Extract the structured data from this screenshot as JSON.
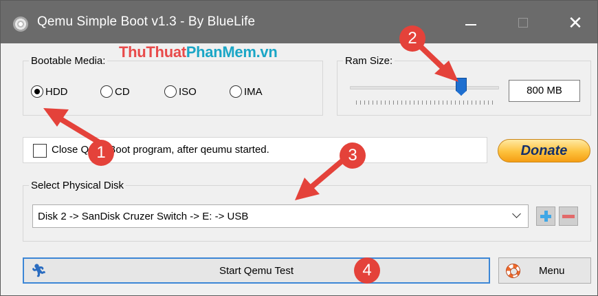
{
  "window": {
    "title": "Qemu Simple Boot v1.3 - By BlueLife",
    "icon": "cd-disc-icon",
    "controls": {
      "minimize": "–",
      "maximize": "□",
      "close": "✕"
    }
  },
  "watermark": {
    "part1": "ThuThuat",
    "part2": "PhanMem",
    "part3": ".vn"
  },
  "bootable_media": {
    "title": "Bootable Media:",
    "options": [
      {
        "label": "HDD",
        "checked": true
      },
      {
        "label": "CD",
        "checked": false
      },
      {
        "label": "ISO",
        "checked": false
      },
      {
        "label": "IMA",
        "checked": false
      }
    ]
  },
  "ram": {
    "title": "Ram Size:",
    "value": "800 MB",
    "slider_fraction": 0.72
  },
  "close_option": {
    "label": "Close QemuBoot program, after qeumu started.",
    "checked": false
  },
  "donate": {
    "label": "Donate"
  },
  "disk": {
    "title": "Select Physical Disk",
    "selected": "Disk 2 -> SanDisk Cruzer Switch -> E: -> USB",
    "add_label": "+",
    "remove_label": "−"
  },
  "actions": {
    "start_label": "Start Qemu Test",
    "menu_label": "Menu"
  },
  "annotations": {
    "step1": "1",
    "step2": "2",
    "step3": "3",
    "step4": "4"
  },
  "colors": {
    "accent": "#3b86d6",
    "badge": "#e4423a",
    "titlebar": "#6b6b6b",
    "donate_text": "#132f6b"
  }
}
